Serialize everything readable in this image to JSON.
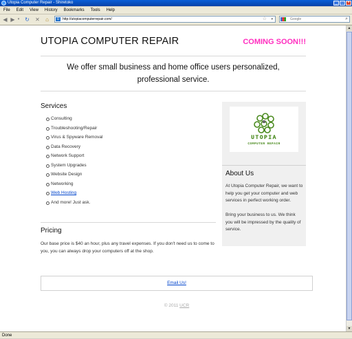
{
  "window": {
    "title": "Utopia Computer Repair - Shiretoko"
  },
  "menu": [
    "File",
    "Edit",
    "View",
    "History",
    "Bookmarks",
    "Tools",
    "Help"
  ],
  "nav": {
    "url": "http://utopiacomputerrepair.com/",
    "search_placeholder": "Google"
  },
  "page": {
    "title": "UTOPIA COMPUTER REPAIR",
    "coming_soon": "COMING SOON!!!",
    "tagline_line1": "We offer small business and home office users personalized,",
    "tagline_line2": "professional service.",
    "services_heading": "Services",
    "services": [
      "Consulting",
      "Troubleshooting/Repair",
      "Virus & Spyware Removal",
      "Data Recovery",
      "Network Support",
      "System Upgrades",
      "Website Design",
      "Networking"
    ],
    "services_link": "Web Hosting",
    "services_last": "And more! Just ask.",
    "pricing_heading": "Pricing",
    "pricing_text": "Our base price is $40 an hour, plus any travel expenses. If you don't need us to come to you, you can always drop your computers off at the shop.",
    "logo_text": "UTOPIA",
    "logo_subtext": "COMPUTER REPAIR",
    "about_heading": "About Us",
    "about_p1": "At Utopia Computer Repair, we want to help you get your computer and web services in perfect working order.",
    "about_p2": "Bring your business to us. We think you will be impressed by the quality of service.",
    "email_link": "Email Us!",
    "footer_prefix": "© 2011",
    "footer_link": "UCR"
  },
  "status": "Done",
  "colors": {
    "coming_soon": "#ff2dbf",
    "logo_green": "#4a8a1e",
    "link": "#0044cc"
  }
}
